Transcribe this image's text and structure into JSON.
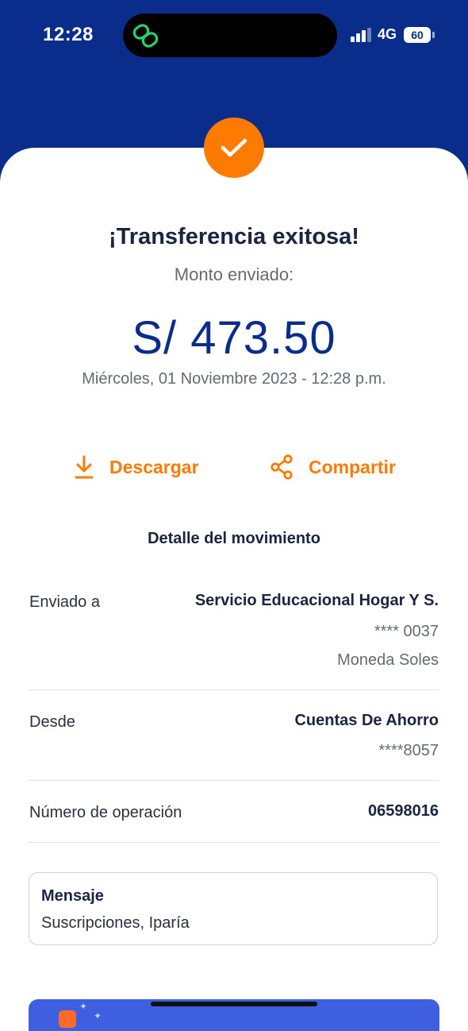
{
  "status_bar": {
    "time": "12:28",
    "network": "4G",
    "battery": "60"
  },
  "receipt": {
    "title": "¡Transferencia exitosa!",
    "subtitle": "Monto enviado:",
    "amount": "S/ 473.50",
    "date": "Miércoles, 01 Noviembre 2023 - 12:28 p.m."
  },
  "actions": {
    "download": "Descargar",
    "share": "Compartir"
  },
  "details": {
    "section_title": "Detalle del movimiento",
    "sent_to": {
      "label": "Enviado a",
      "name": "Servicio Educacional Hogar Y S.",
      "account": "**** 0037",
      "currency": "Moneda Soles"
    },
    "from": {
      "label": "Desde",
      "name": "Cuentas De Ahorro",
      "account": "****8057"
    },
    "operation": {
      "label": "Número de operación",
      "number": "06598016"
    }
  },
  "message": {
    "title": "Mensaje",
    "text": "Suscripciones, Iparía"
  },
  "colors": {
    "brand_blue": "#0a2d8c",
    "accent_orange": "#ff7a00",
    "promo_blue": "#3d5fe0"
  },
  "icons": [
    "link-icon",
    "signal-icon",
    "battery-icon",
    "check-icon",
    "download-icon",
    "share-icon"
  ]
}
